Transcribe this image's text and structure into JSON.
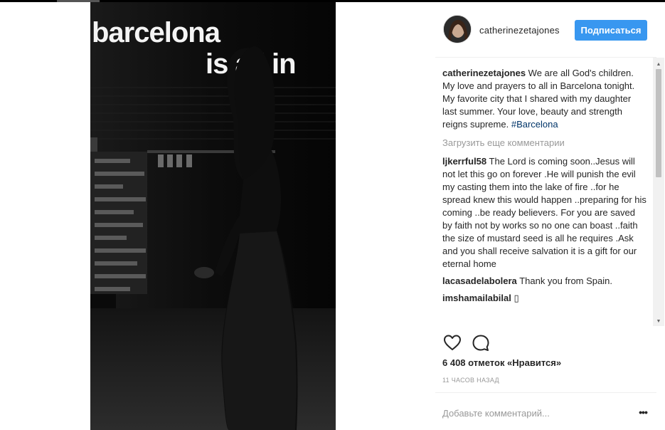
{
  "photo": {
    "overlay_line1": "barcelona",
    "overlay_line2": "is all in"
  },
  "post": {
    "owner_username": "catherinezetajones",
    "follow_label": "Подписаться",
    "caption_user": "catherinezetajones",
    "caption_text": "We are all God's children. My love and prayers to all in Barcelona tonight. My favorite city that I shared with my daughter last summer. Your love, beauty and strength reigns supreme.",
    "caption_hashtag": "#Barcelona",
    "load_more_label": "Загрузить еще комментарии",
    "comments": [
      {
        "user": "ljkerrful58",
        "text": "The Lord is coming soon..Jesus will not let this go on forever .He will punish the evil my casting them into the lake of fire ..for he spread knew this would happen ..preparing for his coming ..be ready believers. For you are saved by faith not by works so no one can boast ..faith the size of mustard seed is all he requires .Ask and you shall receive salvation it is a gift for our eternal home"
      },
      {
        "user": "lacasadelabolera",
        "text": "Thank you from Spain."
      },
      {
        "user": "imshamailabilal",
        "text": "▯"
      }
    ],
    "likes_label": "6 408 отметок «Нравится»",
    "timestamp": "11 ЧАСОВ НАЗАД",
    "add_comment_placeholder": "Добавьте комментарий...",
    "more_options": "•••"
  },
  "icons": {
    "like": "heart-outline-icon",
    "comment": "speech-bubble-icon",
    "more": "ellipsis-icon"
  },
  "colors": {
    "follow_button": "#3897f0",
    "hashtag": "#003569",
    "muted_text": "#999999",
    "text": "#262626"
  }
}
